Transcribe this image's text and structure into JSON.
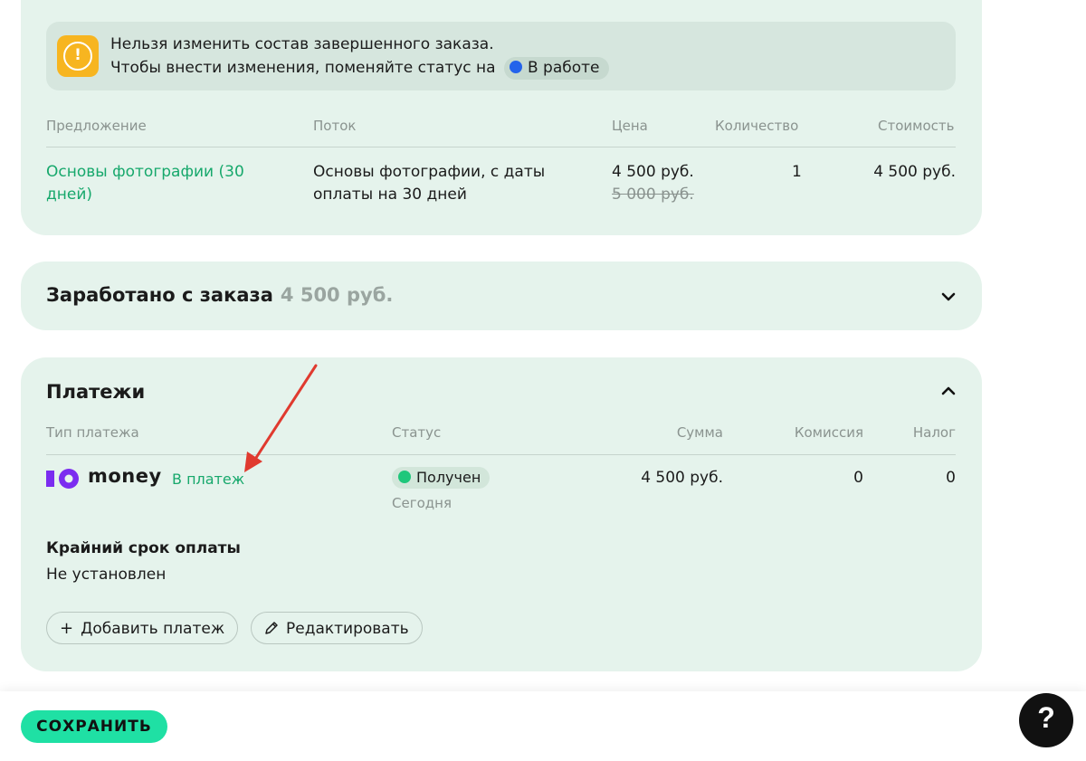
{
  "alert": {
    "line1": "Нельзя изменить состав завершенного заказа.",
    "line2": "Чтобы внести изменения, поменяйте статус на",
    "status_label": "В работе",
    "status_color": "#2463eb"
  },
  "order_table": {
    "headers": [
      "Предложение",
      "Поток",
      "Цена",
      "Количество",
      "Стоимость"
    ],
    "row": {
      "offer": "Основы фотографии (30 дней)",
      "stream": "Основы фотографии, с даты оплаты на 30 дней",
      "price": "4 500 руб.",
      "old_price": "5 000 руб.",
      "quantity": "1",
      "total": "4 500 руб."
    }
  },
  "earned": {
    "title": "Заработано с заказа",
    "amount": "4 500 руб."
  },
  "payments": {
    "title": "Платежи",
    "headers": [
      "Тип платежа",
      "Статус",
      "Сумма",
      "Комиссия",
      "Налог"
    ],
    "row": {
      "provider_name": "money",
      "link": "В платеж",
      "status": "Получен",
      "status_color": "#1fc77b",
      "date": "Сегодня",
      "amount": "4 500 руб.",
      "commission": "0",
      "tax": "0"
    },
    "deadline_label": "Крайний срок оплаты",
    "deadline_value": "Не установлен",
    "add_button": "Добавить платеж",
    "edit_button": "Редактировать"
  },
  "footer": {
    "save_label": "СОХРАНИТЬ",
    "help_label": "?"
  },
  "colors": {
    "accent": "#1fe0a4",
    "link": "#17a86c",
    "card_bg": "#e5f3ec",
    "alert_icon": "#f7b520",
    "annotation_arrow": "#e03a2f",
    "yoomoney": "#7b2cf0"
  }
}
